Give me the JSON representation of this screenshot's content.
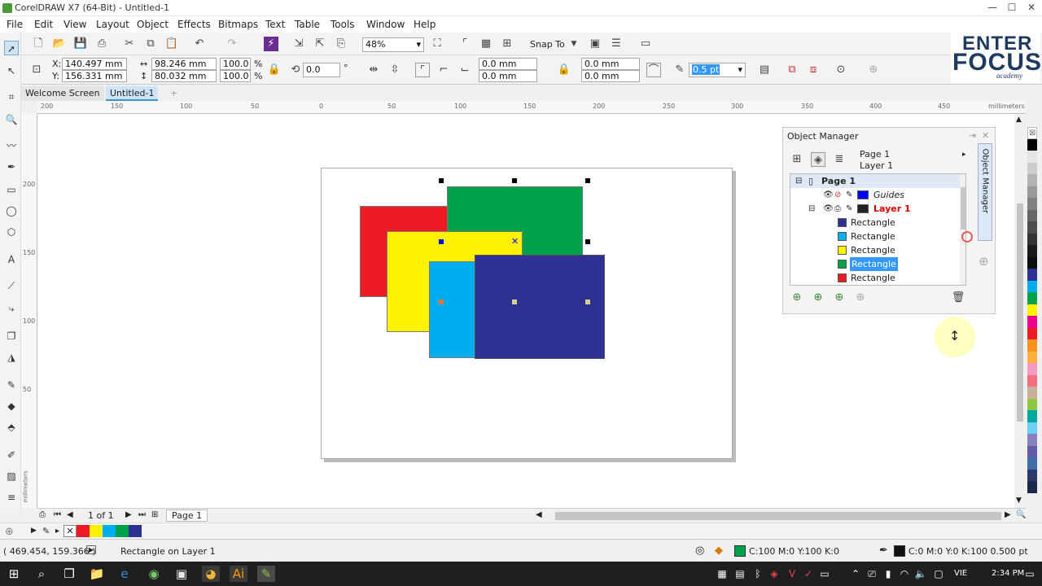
{
  "window": {
    "title": "CorelDRAW X7 (64-Bit) - Untitled-1",
    "min": "—",
    "max": "☐",
    "close": "✕"
  },
  "menu": [
    "File",
    "Edit",
    "View",
    "Layout",
    "Object",
    "Effects",
    "Bitmaps",
    "Text",
    "Table",
    "Tools",
    "Window",
    "Help"
  ],
  "toolbar": {
    "zoom": "48%",
    "snap_to": "Snap To"
  },
  "property_bar": {
    "x_label": "X:",
    "x": "140.497 mm",
    "y_label": "Y:",
    "y": "156.331 mm",
    "w": "98.246 mm",
    "h": "80.032 mm",
    "sx": "100.0",
    "sy": "100.0",
    "pct": "%",
    "rotation": "0.0",
    "deg": "°",
    "corner1": "0.0 mm",
    "corner2": "0.0 mm",
    "corner3": "0.0 mm",
    "corner4": "0.0 mm",
    "outline": "0.5 pt"
  },
  "tabs": {
    "welcome": "Welcome Screen",
    "doc": "Untitled-1",
    "add": "+"
  },
  "ruler": {
    "h_ticks": [
      "200",
      "150",
      "100",
      "50",
      "0",
      "50",
      "100",
      "150",
      "200",
      "250",
      "300",
      "350",
      "400",
      "450"
    ],
    "units": "millimeters",
    "v_ticks": [
      "200",
      "150",
      "100",
      "50"
    ],
    "v_units": "millimeters"
  },
  "canvas": {
    "colors": {
      "red": "#ed1c24",
      "green": "#00a14b",
      "yellow": "#fff200",
      "cyan": "#00aeef",
      "navy": "#2e3192"
    }
  },
  "object_manager": {
    "title": "Object Manager",
    "page": "Page 1",
    "layer": "Layer 1",
    "side_label": "Object Manager",
    "tree": [
      {
        "label": "Page 1",
        "type": "page"
      },
      {
        "label": "Guides",
        "type": "layer",
        "color": "#0000ff"
      },
      {
        "label": "Layer 1",
        "type": "layer",
        "color": "#222222"
      },
      {
        "label": "Rectangle",
        "type": "object",
        "color": "#2e3192"
      },
      {
        "label": "Rectangle",
        "type": "object",
        "color": "#00aeef"
      },
      {
        "label": "Rectangle",
        "type": "object",
        "color": "#fff200"
      },
      {
        "label": "Rectangle",
        "type": "object",
        "color": "#00a14b",
        "selected": true
      },
      {
        "label": "Rectangle",
        "type": "object",
        "color": "#ed1c24"
      }
    ]
  },
  "palette": [
    "#ffffff",
    "#000000",
    "#e5e5e5",
    "#cccccc",
    "#b3b3b3",
    "#999999",
    "#808080",
    "#666666",
    "#4d4d4d",
    "#333333",
    "#1a1a1a",
    "#0d0d0d",
    "#2e3192",
    "#00aeef",
    "#00a14b",
    "#fff200",
    "#ec008c",
    "#ed1c24",
    "#f7941d",
    "#fbb040",
    "#f49ac1",
    "#f26d7d",
    "#c7b299",
    "#8dc63f",
    "#00a99d",
    "#6dcff6",
    "#8781bd",
    "#605ca8",
    "#3f6ea8",
    "#2b3a67",
    "#1b2a4a"
  ],
  "pager": {
    "page_of": "1 of 1",
    "page_tab": "Page 1"
  },
  "doc_palette": [
    "#ed1c24",
    "#fff200",
    "#00aeef",
    "#00a14b",
    "#2e3192"
  ],
  "status": {
    "coords": "( 469.454, 159.366 )",
    "info": "Rectangle on Layer 1",
    "fill": "C:100 M:0 Y:100 K:0",
    "fill_color": "#00a14b",
    "outline": "C:0 M:0 Y:0 K:100  0.500 pt"
  },
  "taskbar": {
    "lang": "VIE",
    "time": "2:34 PM"
  },
  "logo": {
    "line1": "ENTER",
    "line2": "FOCUS",
    "line3": "academy"
  }
}
